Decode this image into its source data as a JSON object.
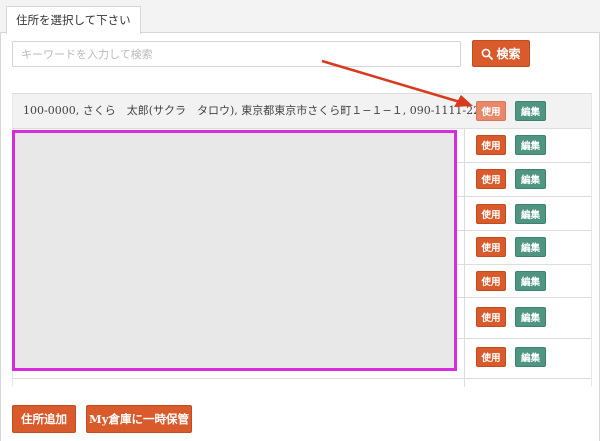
{
  "tab": {
    "label": "住所を選択して下さい"
  },
  "search": {
    "placeholder": "キーワードを入力して検索",
    "value": "",
    "button_label": "検索"
  },
  "address_rows": [
    {
      "text": "100-0000,  さくら　太郎(サクラ　タロウ),  東京都東京市さくら町１−１−１,  090-1111-2222",
      "use_label": "使用",
      "edit_label": "編集"
    },
    {
      "text": "",
      "use_label": "使用",
      "edit_label": "編集"
    },
    {
      "text": "",
      "use_label": "使用",
      "edit_label": "編集"
    },
    {
      "text": "",
      "use_label": "使用",
      "edit_label": "編集"
    },
    {
      "text": "",
      "use_label": "使用",
      "edit_label": "編集"
    },
    {
      "text": "",
      "use_label": "使用",
      "edit_label": "編集"
    },
    {
      "text": "",
      "use_label": "使用",
      "edit_label": "編集"
    },
    {
      "text": "",
      "use_label": "使用",
      "edit_label": "編集"
    }
  ],
  "footer": {
    "add_address_label": "住所追加",
    "temp_store_label": "My倉庫に一時保管"
  },
  "colors": {
    "accent_orange": "#d95a2b",
    "edit_green": "#4f9582",
    "highlight_magenta": "#d82bdc",
    "arrow_red": "#d93a1e"
  }
}
